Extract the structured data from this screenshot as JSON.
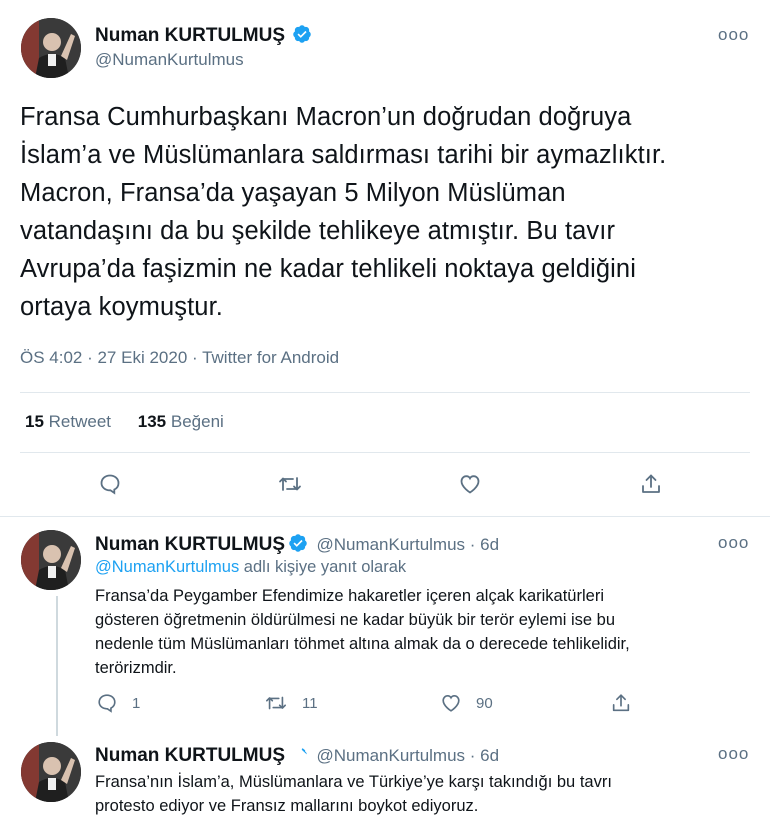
{
  "main_tweet": {
    "author_name": "Numan KURTULMUŞ",
    "author_handle": "@NumanKurtulmus",
    "text_lines": [
      "Fransa Cumhurbaşkanı Macron’un doğrudan doğruya",
      "İslam’a ve Müslümanlara saldırması tarihi bir aymazlıktır.",
      "Macron, Fransa’da yaşayan 5 Milyon Müslüman",
      "vatandaşını da bu şekilde tehlikeye atmıştır. Bu tavır",
      "Avrupa’da faşizmin ne kadar tehlikeli noktaya geldiğini",
      "ortaya koymuştur."
    ],
    "meta": "ÖS 4:02 · 27 Eki 2020 · Twitter for Android",
    "retweet_count": "15",
    "retweet_label": "Retweet",
    "like_count": "135",
    "like_label": "Beğeni"
  },
  "replies": [
    {
      "author_name": "Numan KURTULMUŞ",
      "author_handle": "@NumanKurtulmus · 6d",
      "replying_handle": "@NumanKurtulmus",
      "replying_suffix": " adlı kişiye yanıt olarak",
      "text_lines": [
        "Fransa’da Peygamber Efendimize hakaretler içeren alçak karikatürleri",
        "gösteren öğretmenin öldürülmesi ne kadar büyük bir terör eylemi ise bu",
        "nedenle tüm Müslümanları töhmet altına almak da o derecede tehlikelidir,",
        "terörizmdir."
      ],
      "reply_count": "1",
      "retweet_count": "11",
      "like_count": "90"
    },
    {
      "author_name": "Numan KURTULMUŞ",
      "author_handle": "@NumanKurtulmus · 6d",
      "text_lines": [
        "Fransa’nın İslam’a, Müslümanlara ve Türkiye’ye karşı takındığı bu tavrı",
        "protesto ediyor ve Fransız mallarını boykot ediyoruz."
      ]
    }
  ],
  "more_glyph": "ooo",
  "colors": {
    "verified": "#1da1f2",
    "secondary_text": "#5b7083",
    "link": "#1da1f2",
    "divider": "#e1e8ed"
  },
  "icons": [
    "verified-badge-icon",
    "more-options-icon",
    "reply-icon",
    "retweet-icon",
    "like-icon",
    "share-icon"
  ]
}
